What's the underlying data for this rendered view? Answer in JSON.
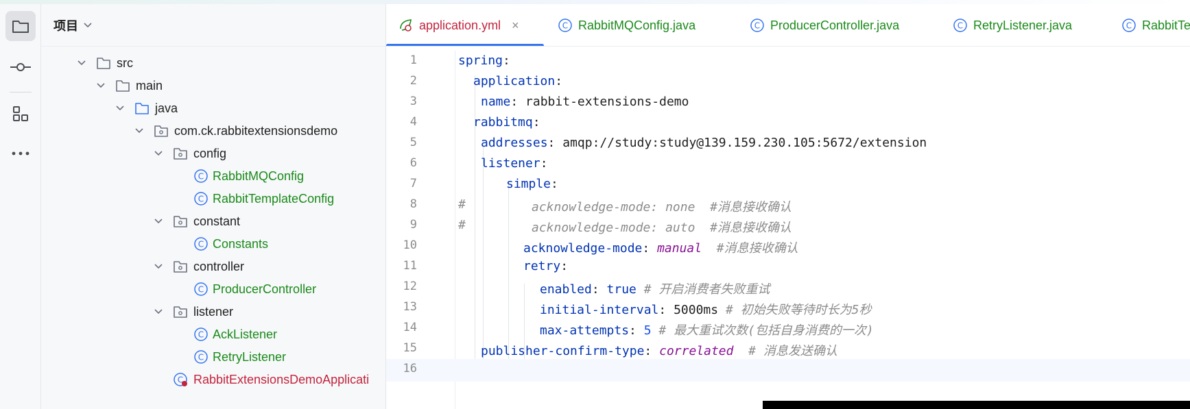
{
  "colors": {
    "accent": "#3574f0",
    "class_name": "#1a8a1a",
    "main_class_name": "#c3243d",
    "yaml_key": "#0033b3",
    "enum_value": "#871094",
    "comment": "#8c8c8c"
  },
  "activity_bar": {
    "items": [
      {
        "name": "project",
        "icon": "folder-icon",
        "active": true
      },
      {
        "name": "commit",
        "icon": "commit-icon",
        "active": false
      },
      {
        "name": "structure",
        "icon": "structure-icon",
        "active": false
      },
      {
        "name": "more",
        "icon": "more-icon",
        "active": false
      }
    ]
  },
  "project_panel": {
    "title": "项目",
    "tree": [
      {
        "label": "src",
        "type": "folder",
        "expanded": true
      },
      {
        "label": "main",
        "type": "folder",
        "expanded": true
      },
      {
        "label": "java",
        "type": "source-folder",
        "expanded": true
      },
      {
        "label": "com.ck.rabbitextensionsdemo",
        "type": "package",
        "expanded": true
      },
      {
        "label": "config",
        "type": "package",
        "expanded": true
      },
      {
        "label": "RabbitMQConfig",
        "type": "class"
      },
      {
        "label": "RabbitTemplateConfig",
        "type": "class"
      },
      {
        "label": "constant",
        "type": "package",
        "expanded": true
      },
      {
        "label": "Constants",
        "type": "class"
      },
      {
        "label": "controller",
        "type": "package",
        "expanded": true
      },
      {
        "label": "ProducerController",
        "type": "class"
      },
      {
        "label": "listener",
        "type": "package",
        "expanded": true
      },
      {
        "label": "AckListener",
        "type": "class"
      },
      {
        "label": "RetryListener",
        "type": "class"
      },
      {
        "label": "RabbitExtensionsDemoApplicati",
        "type": "main-class"
      }
    ]
  },
  "editor": {
    "tabs": [
      {
        "label": "application.yml",
        "active": true,
        "icon": "yaml-icon",
        "close": "×"
      },
      {
        "label": "RabbitMQConfig.java",
        "active": false,
        "icon": "class-icon"
      },
      {
        "label": "ProducerController.java",
        "active": false,
        "icon": "class-icon"
      },
      {
        "label": "RetryListener.java",
        "active": false,
        "icon": "class-icon"
      },
      {
        "label": "RabbitTe",
        "active": false,
        "icon": "class-icon"
      }
    ],
    "line_numbers": [
      "1",
      "2",
      "3",
      "4",
      "5",
      "6",
      "7",
      "8",
      "9",
      "10",
      "11",
      "12",
      "13",
      "14",
      "15",
      "16"
    ],
    "lines": {
      "l1": {
        "key": "spring",
        "sep": ":"
      },
      "l2": {
        "key": "application",
        "sep": ":"
      },
      "l3": {
        "key": "name",
        "sep": ": ",
        "value": "rabbit-extensions-demo"
      },
      "l4": {
        "key": "rabbitmq",
        "sep": ":"
      },
      "l5": {
        "key": "addresses",
        "sep": ": ",
        "value": "amqp://study:study@139.159.230.105:5672/extension"
      },
      "l6": {
        "key": "listener",
        "sep": ":"
      },
      "l7": {
        "key": "simple",
        "sep": ":"
      },
      "l8": {
        "hash": "#",
        "text": "acknowledge-mode: none  #消息接收确认"
      },
      "l9": {
        "hash": "#",
        "text": "acknowledge-mode: auto  #消息接收确认"
      },
      "l10": {
        "key": "acknowledge-mode",
        "sep": ": ",
        "value": "manual",
        "comment": "#消息接收确认"
      },
      "l11": {
        "key": "retry",
        "sep": ":"
      },
      "l12": {
        "key": "enabled",
        "sep": ": ",
        "value": "true",
        "comment": "# 开启消费者失败重试"
      },
      "l13": {
        "key": "initial-interval",
        "sep": ": ",
        "value": "5000ms",
        "comment": "# 初始失败等待时长为5秒"
      },
      "l14": {
        "key": "max-attempts",
        "sep": ": ",
        "value": "5",
        "comment": "# 最大重试次数(包括自身消费的一次)"
      },
      "l15": {
        "key": "publisher-confirm-type",
        "sep": ": ",
        "value": "correlated",
        "comment": "# 消息发送确认"
      }
    }
  }
}
